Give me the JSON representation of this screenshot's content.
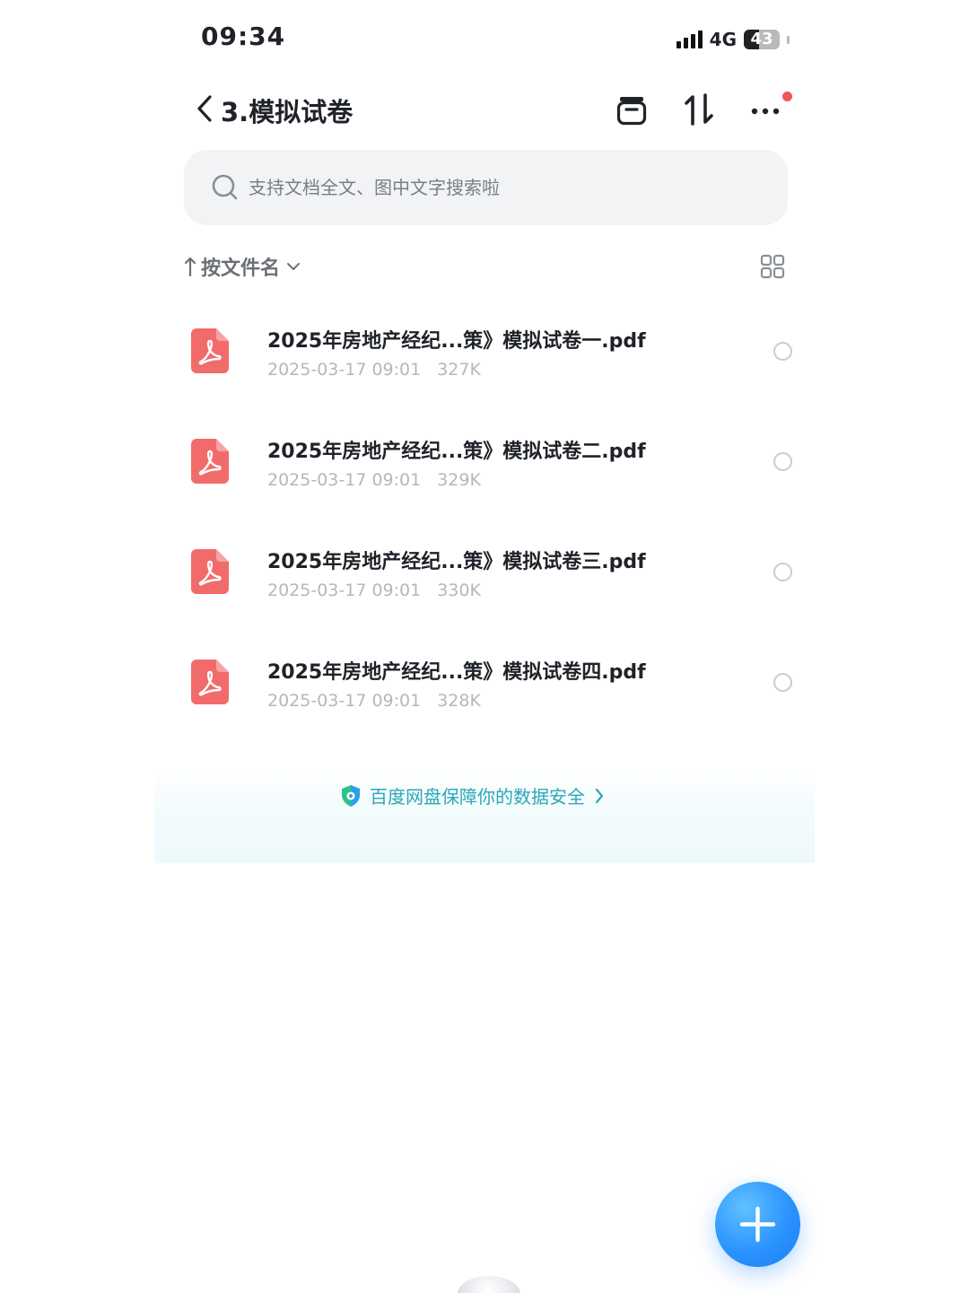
{
  "status_bar": {
    "time": "09:34",
    "network": "4G",
    "battery": "43",
    "battery_level": 0.43
  },
  "header": {
    "title": "3.模拟试卷",
    "icons": [
      "back-icon",
      "archive-icon",
      "sort-arrows-icon",
      "more-icon"
    ],
    "notification_dot_color": "#f2555a"
  },
  "search": {
    "placeholder": "支持文档全文、图中文字搜索啦"
  },
  "sort": {
    "label": "按文件名"
  },
  "files": [
    {
      "name": "2025年房地产经纪...策》模拟试卷一.pdf",
      "date": "2025-03-17 09:01",
      "size": "327K",
      "selected": false
    },
    {
      "name": "2025年房地产经纪...策》模拟试卷二.pdf",
      "date": "2025-03-17 09:01",
      "size": "329K",
      "selected": false
    },
    {
      "name": "2025年房地产经纪...策》模拟试卷三.pdf",
      "date": "2025-03-17 09:01",
      "size": "330K",
      "selected": false
    },
    {
      "name": "2025年房地产经纪...策》模拟试卷四.pdf",
      "date": "2025-03-17 09:01",
      "size": "328K",
      "selected": false
    }
  ],
  "security_banner": {
    "text": "百度网盘保障你的数据安全"
  },
  "colors": {
    "pdf_icon": "#f26b6b",
    "security_text": "#2aa7b8",
    "fab": "#2a93ff"
  }
}
